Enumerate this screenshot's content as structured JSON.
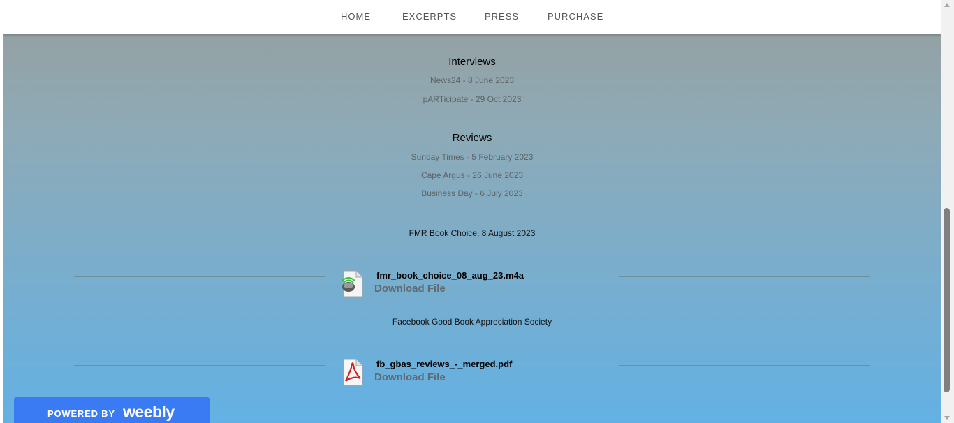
{
  "nav": {
    "items": [
      {
        "label": "HOME"
      },
      {
        "label": "EXCERPTS"
      },
      {
        "label": "PRESS"
      },
      {
        "label": "PURCHASE"
      }
    ]
  },
  "interviews": {
    "heading": "Interviews",
    "links": [
      "News24 - 8 June 2023",
      "pARTicipate - 29 Oct 2023"
    ]
  },
  "reviews": {
    "heading": "Reviews",
    "links": [
      "Sunday Times - 5 February 2023",
      "Cape Argus - 26 June 2023",
      "Business Day - 6 July 2023"
    ]
  },
  "files": [
    {
      "caption": "FMR Book Choice, 8 August 2023",
      "filename": "fmr_book_choice_08_aug_23.m4a",
      "download_label": "Download File",
      "icon": "audio-file-icon"
    },
    {
      "caption": "Facebook Good Book Appreciation Society",
      "filename": "fb_gbas_reviews_-_merged.pdf",
      "download_label": "Download File",
      "icon": "pdf-file-icon"
    }
  ],
  "badge": {
    "powered_by": "POWERED BY",
    "brand": "weebly"
  },
  "colors": {
    "background_top": "#969e9d",
    "background_bottom": "#63b1e4",
    "badge": "#3a7bf3"
  }
}
